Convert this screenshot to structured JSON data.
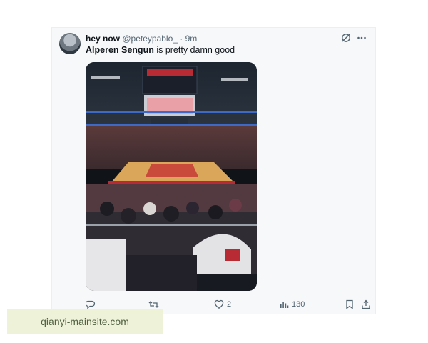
{
  "tweet": {
    "display_name": "hey now",
    "handle": "@peteypablo_",
    "separator": "·",
    "time": "9m",
    "text_mention": "Alperen Sengun",
    "text_rest": " is pretty damn good",
    "image_description_icon": "arena-photo"
  },
  "header_icons": [
    "grok-icon",
    "more-icon"
  ],
  "actions": {
    "reply_count": "",
    "retweet_count": "",
    "like_count": "2",
    "views_count": "130"
  },
  "watermark": {
    "text": "qianyi-mainsite.com"
  },
  "colors": {
    "text_primary": "#0f1419",
    "text_secondary": "#536471",
    "card_bg": "#f7f8fa"
  }
}
